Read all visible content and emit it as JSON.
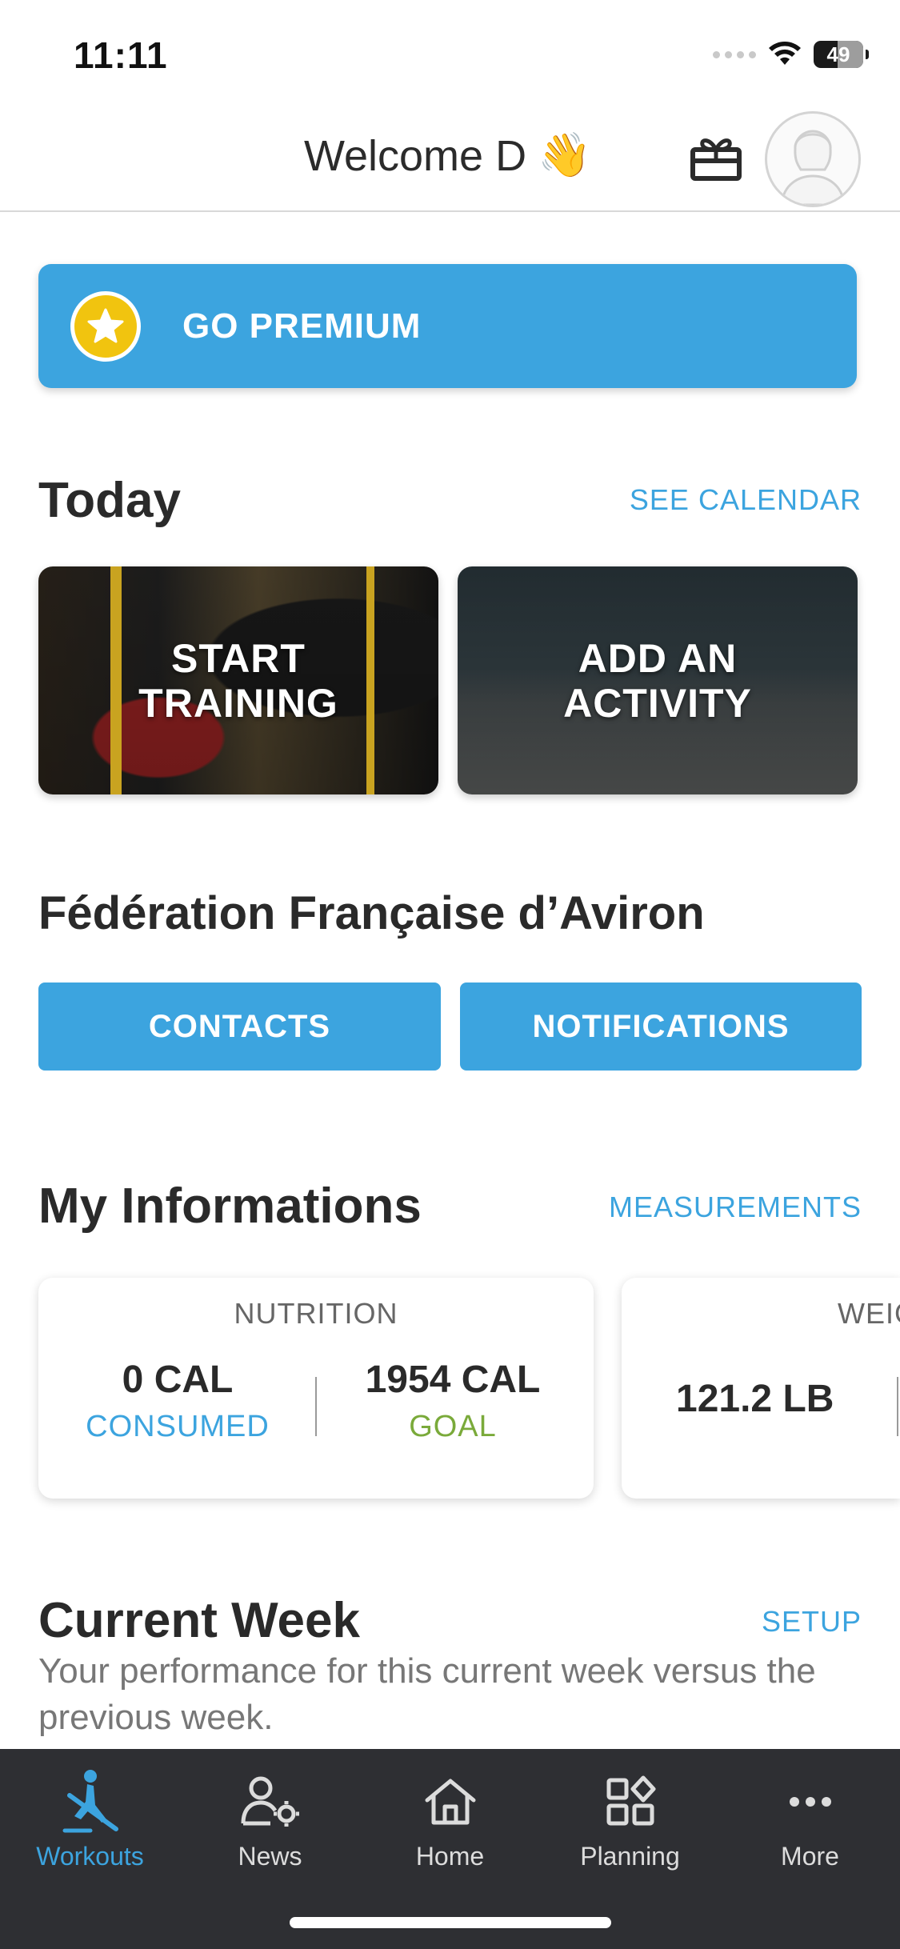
{
  "status_bar": {
    "time": "11:11",
    "battery": "49",
    "icons": [
      "cellular-signal-icon",
      "wifi-icon",
      "battery-icon"
    ]
  },
  "header": {
    "welcome": "Welcome D",
    "wave_emoji": "👋",
    "gift_icon": "gift-icon",
    "avatar_icon": "user-avatar-icon"
  },
  "premium": {
    "label": "GO PREMIUM",
    "icon": "star-icon"
  },
  "today": {
    "title": "Today",
    "link": "SEE CALENDAR",
    "cards": [
      {
        "label": "START\nTRAINING"
      },
      {
        "label": "ADD AN\nACTIVITY"
      }
    ]
  },
  "federation": {
    "title": "Fédération Française d’Aviron",
    "buttons": [
      "CONTACTS",
      "NOTIFICATIONS"
    ]
  },
  "informations": {
    "title": "My Informations",
    "link": "MEASUREMENTS",
    "nutrition": {
      "title": "NUTRITION",
      "consumed_value": "0 CAL",
      "consumed_label": "CONSUMED",
      "goal_value": "1954 CAL",
      "goal_label": "GOAL"
    },
    "weight": {
      "title": "WEIG",
      "value": "121.2 LB"
    }
  },
  "current_week": {
    "title": "Current Week",
    "link": "SETUP",
    "description": "Your performance for this current week versus the previous week."
  },
  "tab_bar": {
    "tabs": [
      {
        "label": "Workouts",
        "icon": "rowing-person-icon",
        "active": true
      },
      {
        "label": "News",
        "icon": "person-gear-icon",
        "active": false
      },
      {
        "label": "Home",
        "icon": "home-icon",
        "active": false
      },
      {
        "label": "Planning",
        "icon": "grid-shapes-icon",
        "active": false
      },
      {
        "label": "More",
        "icon": "more-dots-icon",
        "active": false
      }
    ]
  },
  "colors": {
    "accent": "#3ca4df",
    "goal_green": "#7aaa3a",
    "tab_bar_bg": "#2e2f33",
    "star_badge": "#f1c40f"
  }
}
